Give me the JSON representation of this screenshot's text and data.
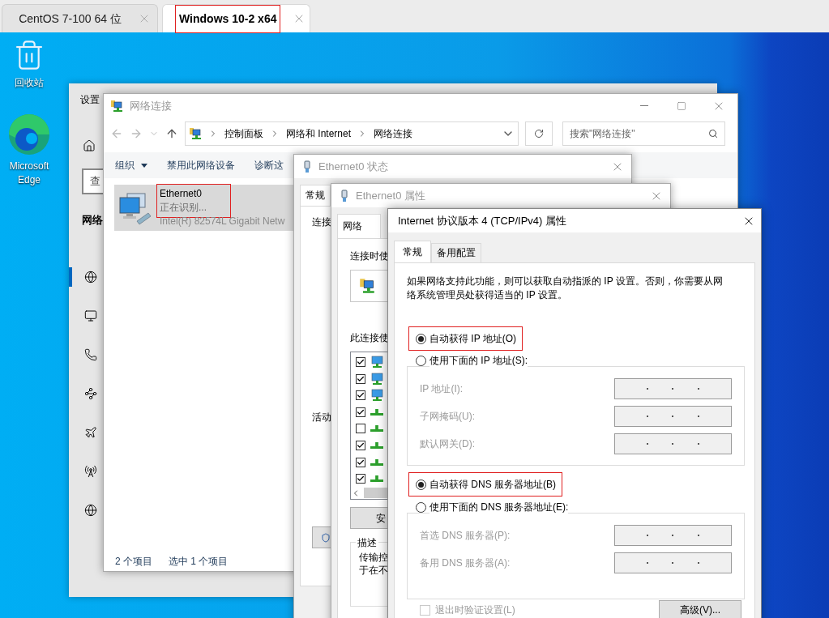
{
  "vm_tabs": [
    {
      "label": "CentOS 7-100 64 位",
      "selected": false,
      "highlighted": false
    },
    {
      "label": "Windows 10-2 x64",
      "selected": true,
      "highlighted": true
    }
  ],
  "desktop_icons": [
    {
      "kind": "recycle-bin",
      "label": "回收站"
    },
    {
      "kind": "edge",
      "label": "Microsoft Edge"
    }
  ],
  "settings_window": {
    "title": "设置",
    "search_placeholder": "查",
    "section": "网络",
    "nav": [
      {
        "kind": "status",
        "selected": true
      },
      {
        "kind": "ethernet",
        "selected": false
      },
      {
        "kind": "dialup",
        "selected": false
      },
      {
        "kind": "vpn",
        "selected": false
      },
      {
        "kind": "airplane",
        "selected": false
      },
      {
        "kind": "hotspot",
        "selected": false
      },
      {
        "kind": "proxy",
        "selected": false
      }
    ]
  },
  "network_connections": {
    "title": "网络连接",
    "breadcrumb": [
      "控制面板",
      "网络和 Internet",
      "网络连接"
    ],
    "search_placeholder": "搜索\"网络连接\"",
    "toolbar": [
      {
        "label": "组织",
        "dropdown": true
      },
      {
        "label": "禁用此网络设备",
        "dropdown": false
      },
      {
        "label": "诊断这",
        "dropdown": false
      }
    ],
    "items": [
      {
        "name": "Ethernet0",
        "status": "正在识别...",
        "device": "Intel(R) 82574L Gigabit Netw",
        "selected": true,
        "highlighted": true
      }
    ],
    "status_bar": [
      "2 个项目",
      "选中 1 个项目"
    ]
  },
  "status_window": {
    "title": "Ethernet0 状态",
    "tab": "常规",
    "labels": [
      "连接",
      "活动"
    ]
  },
  "properties_window": {
    "title": "Ethernet0 属性",
    "tab": "网络",
    "connect_using_label": "连接时使",
    "components_label": "此连接使",
    "components": [
      {
        "kind": "client",
        "checked": true
      },
      {
        "kind": "client",
        "checked": true
      },
      {
        "kind": "client",
        "checked": true
      },
      {
        "kind": "protocol",
        "checked": true
      },
      {
        "kind": "protocol",
        "checked": false
      },
      {
        "kind": "protocol",
        "checked": true
      },
      {
        "kind": "protocol",
        "checked": true
      },
      {
        "kind": "protocol",
        "checked": true
      }
    ],
    "install_button": "安",
    "description_title": "描述",
    "description_lines": [
      "传输控",
      "于在不"
    ]
  },
  "ipv4_window": {
    "title": "Internet 协议版本 4 (TCP/IPv4) 属性",
    "tabs": [
      {
        "label": "常规",
        "selected": true
      },
      {
        "label": "备用配置",
        "selected": false
      }
    ],
    "intro": "如果网络支持此功能，则可以获取自动指派的 IP 设置。否则，你需要从网络系统管理员处获得适当的 IP 设置。",
    "ip_options": [
      {
        "label": "自动获得 IP 地址(O)",
        "selected": true,
        "highlighted": true
      },
      {
        "label": "使用下面的 IP 地址(S):",
        "selected": false,
        "highlighted": false
      }
    ],
    "ip_fields": [
      {
        "label": "IP 地址(I):",
        "disabled": true
      },
      {
        "label": "子网掩码(U):",
        "disabled": true
      },
      {
        "label": "默认网关(D):",
        "disabled": true
      }
    ],
    "dns_options": [
      {
        "label": "自动获得 DNS 服务器地址(B)",
        "selected": true,
        "highlighted": true
      },
      {
        "label": "使用下面的 DNS 服务器地址(E):",
        "selected": false,
        "highlighted": false
      }
    ],
    "dns_fields": [
      {
        "label": "首选 DNS 服务器(P):",
        "disabled": true
      },
      {
        "label": "备用 DNS 服务器(A):",
        "disabled": true
      }
    ],
    "validate_checkbox": {
      "label": "退出时验证设置(L)",
      "checked": false,
      "disabled": true
    },
    "advanced_button": "高级(V)..."
  }
}
